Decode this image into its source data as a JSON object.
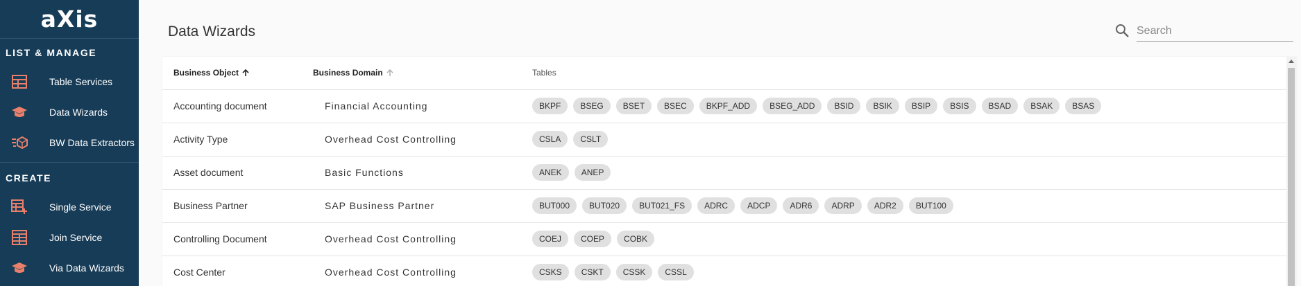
{
  "app": {
    "logo": "aXis"
  },
  "sidebar": {
    "sections": [
      {
        "title": "LIST & MANAGE",
        "items": [
          {
            "label": "Table Services",
            "icon": "table-icon"
          },
          {
            "label": "Data Wizards",
            "icon": "wizard-cap-icon"
          },
          {
            "label": "BW Data Extractors",
            "icon": "extractor-cube-icon"
          }
        ]
      },
      {
        "title": "CREATE",
        "items": [
          {
            "label": "Single Service",
            "icon": "table-plus-icon"
          },
          {
            "label": "Join Service",
            "icon": "join-table-icon"
          },
          {
            "label": "Via Data Wizards",
            "icon": "wizard-cap-icon"
          }
        ]
      }
    ],
    "icon_color": "#e8806b",
    "background": "#173c57"
  },
  "main": {
    "title": "Data Wizards",
    "search": {
      "placeholder": "Search",
      "value": ""
    },
    "table": {
      "headers": {
        "business_object": "Business Object",
        "business_domain": "Business Domain",
        "tables": "Tables"
      },
      "sort": {
        "business_object": "ascending-active",
        "business_domain": "ascending-inactive"
      },
      "rows": [
        {
          "object": "Accounting document",
          "domain": "Financial Accounting",
          "tables": [
            "BKPF",
            "BSEG",
            "BSET",
            "BSEC",
            "BKPF_ADD",
            "BSEG_ADD",
            "BSID",
            "BSIK",
            "BSIP",
            "BSIS",
            "BSAD",
            "BSAK",
            "BSAS"
          ]
        },
        {
          "object": "Activity Type",
          "domain": "Overhead Cost Controlling",
          "tables": [
            "CSLA",
            "CSLT"
          ]
        },
        {
          "object": "Asset document",
          "domain": "Basic Functions",
          "tables": [
            "ANEK",
            "ANEP"
          ]
        },
        {
          "object": "Business Partner",
          "domain": "SAP Business Partner",
          "tables": [
            "BUT000",
            "BUT020",
            "BUT021_FS",
            "ADRC",
            "ADCP",
            "ADR6",
            "ADRP",
            "ADR2",
            "BUT100"
          ]
        },
        {
          "object": "Controlling Document",
          "domain": "Overhead Cost Controlling",
          "tables": [
            "COEJ",
            "COEP",
            "COBK"
          ]
        },
        {
          "object": "Cost Center",
          "domain": "Overhead Cost Controlling",
          "tables": [
            "CSKS",
            "CSKT",
            "CSSK",
            "CSSL"
          ]
        }
      ]
    }
  }
}
